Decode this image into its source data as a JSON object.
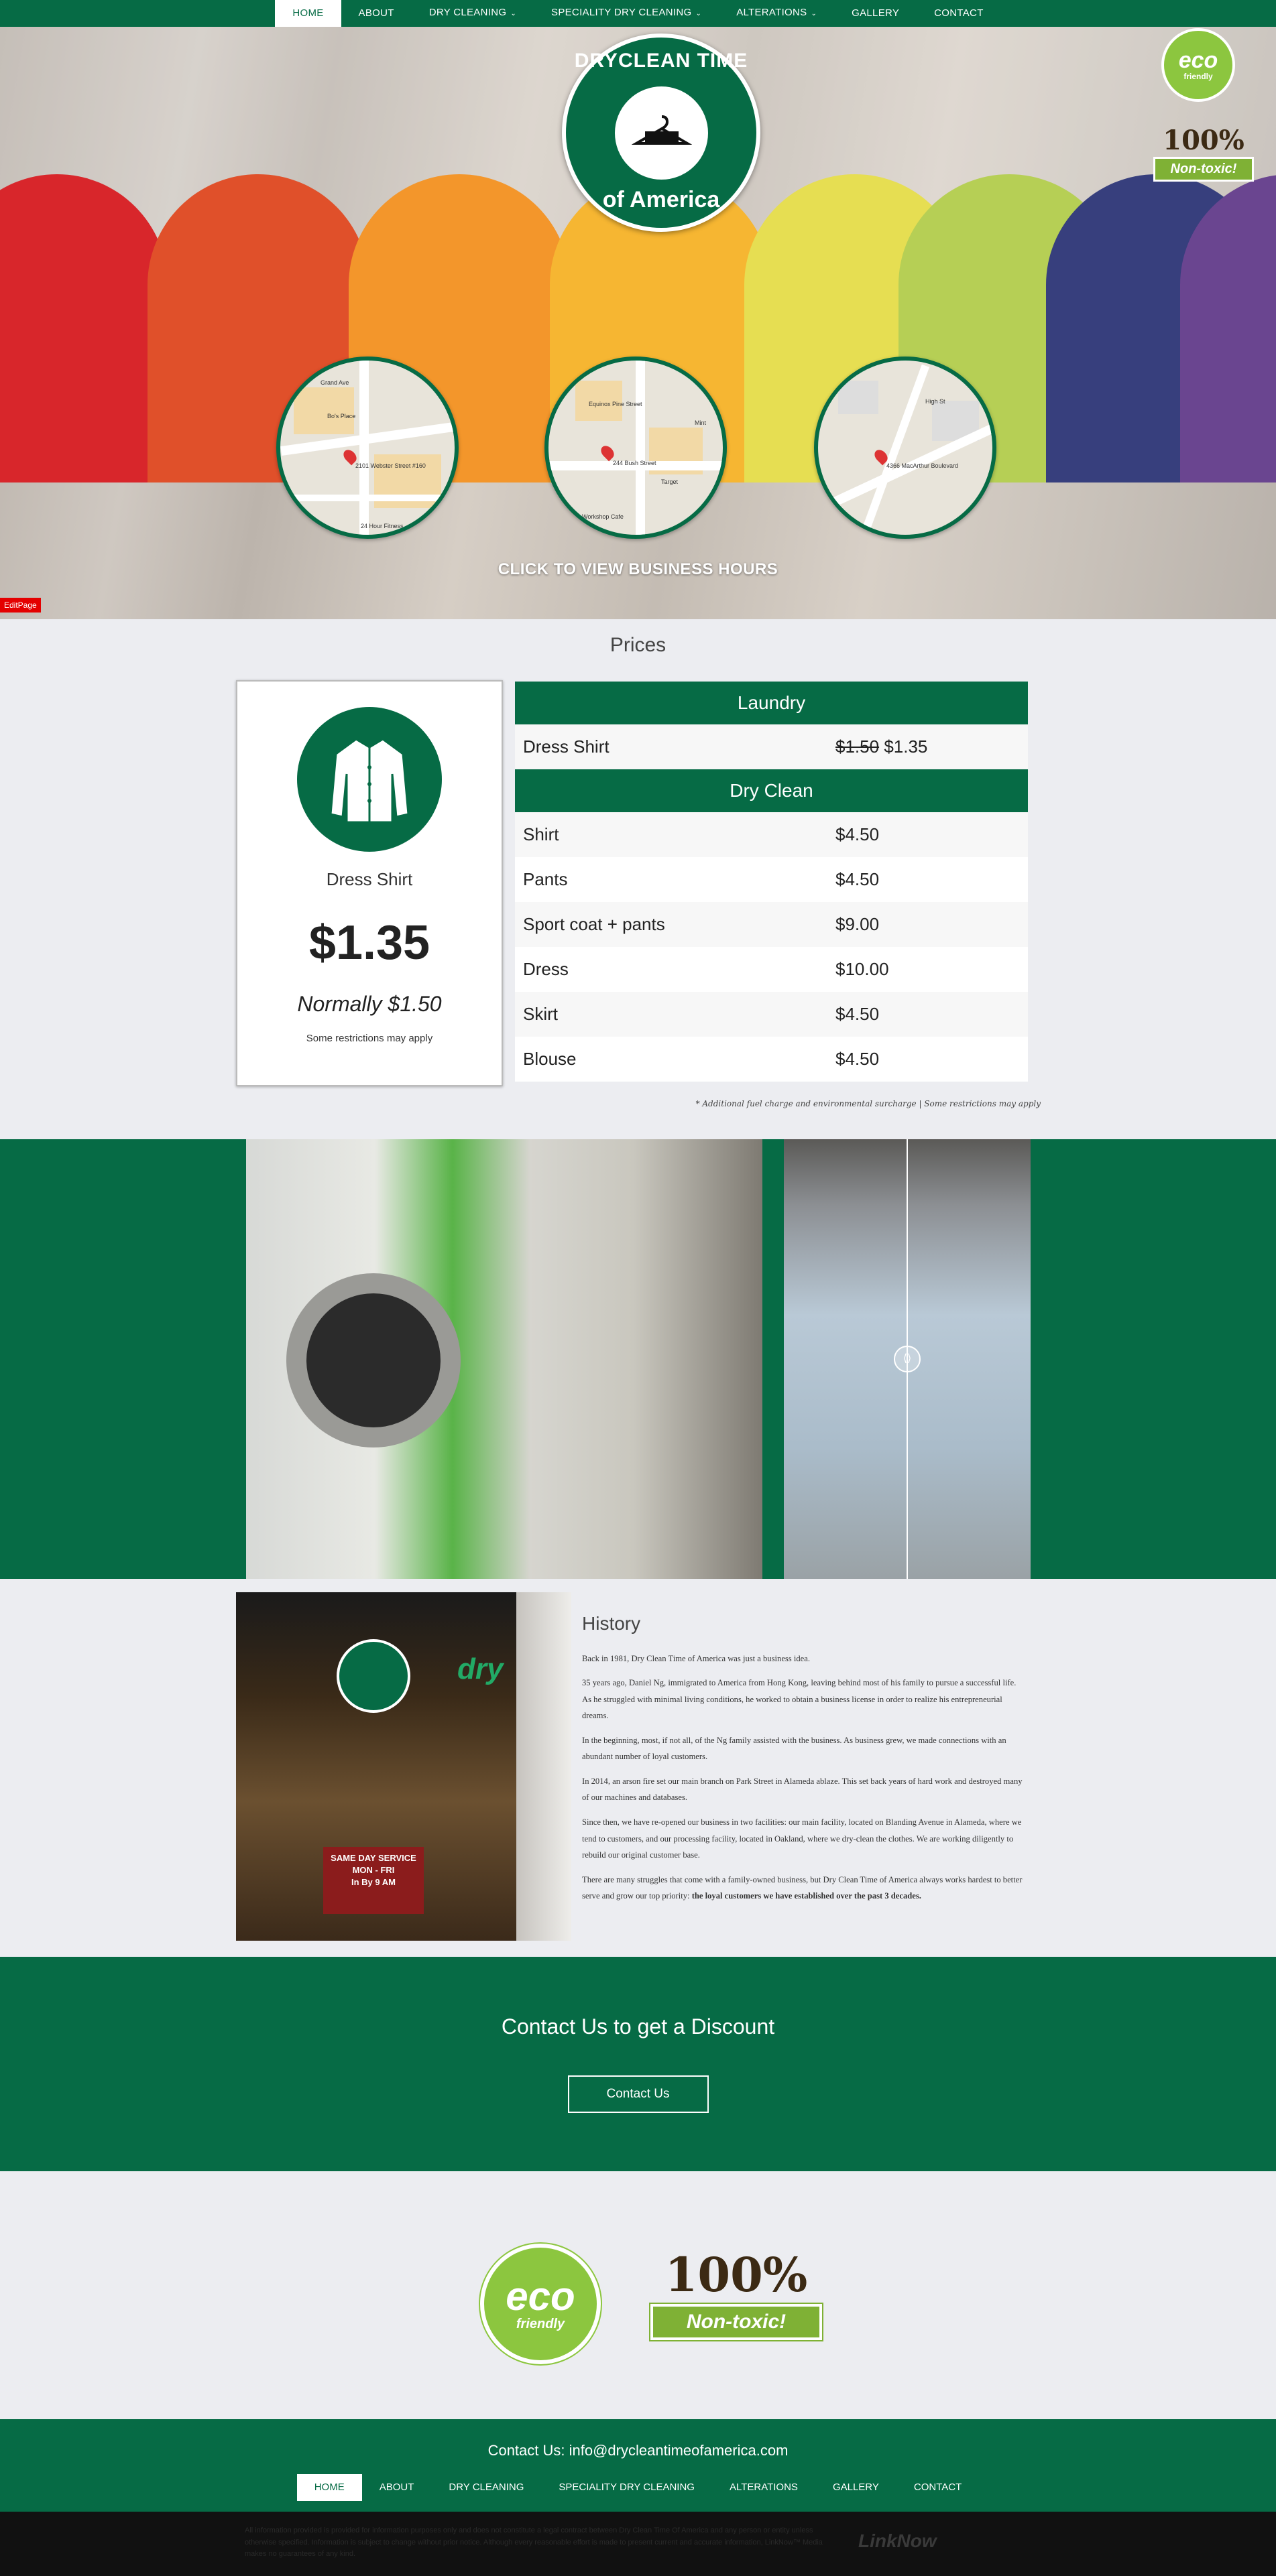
{
  "nav": {
    "items": [
      {
        "label": "HOME",
        "active": true,
        "caret": ""
      },
      {
        "label": "ABOUT",
        "active": false,
        "caret": ""
      },
      {
        "label": "DRY CLEANING",
        "active": false,
        "caret": "⌄"
      },
      {
        "label": "SPECIALITY DRY CLEANING",
        "active": false,
        "caret": "⌄"
      },
      {
        "label": "ALTERATIONS",
        "active": false,
        "caret": "⌄"
      },
      {
        "label": "GALLERY",
        "active": false,
        "caret": ""
      },
      {
        "label": "CONTACT",
        "active": false,
        "caret": ""
      }
    ]
  },
  "hero": {
    "logo_top": "DRYCLEAN TIME",
    "logo_bottom": "of America",
    "eco_big": "eco",
    "eco_small": "friendly",
    "nontoxic_pct": "100%",
    "nontoxic_label": "Non-toxic!",
    "maps": [
      {
        "address": "2101 Webster Street #160",
        "labels": [
          "Grand Ave",
          "Bo's Place",
          "24 Hour Fitness"
        ]
      },
      {
        "address": "244 Bush Street",
        "labels": [
          "Equinox Pine Street",
          "Mint",
          "Target",
          "Workshop Cafe"
        ]
      },
      {
        "address": "4366 MacArthur Boulevard",
        "labels": [
          "High St"
        ]
      }
    ],
    "hours_link": "CLICK TO VIEW BUSINESS HOURS",
    "edit_page": "EditPage"
  },
  "prices": {
    "title": "Prices",
    "promo": {
      "item": "Dress Shirt",
      "price": "$1.35",
      "normally": "Normally $1.50",
      "restrictions": "Some restrictions may apply"
    },
    "laundry_head": "Laundry",
    "laundry": [
      {
        "name": "Dress Shirt",
        "old": "$1.50",
        "value": "$1.35"
      }
    ],
    "dryclean_head": "Dry Clean",
    "dryclean": [
      {
        "name": "Shirt",
        "value": "$4.50"
      },
      {
        "name": "Pants",
        "value": "$4.50"
      },
      {
        "name": "Sport coat + pants",
        "value": "$9.00"
      },
      {
        "name": "Dress",
        "value": "$10.00"
      },
      {
        "name": "Skirt",
        "value": "$4.50"
      },
      {
        "name": "Blouse",
        "value": "$4.50"
      }
    ],
    "fine_print": "* Additional fuel charge and environmental surcharge | Some restrictions may apply"
  },
  "photos": {
    "handle_icon": "⟨⟩"
  },
  "history": {
    "title": "History",
    "storefront": {
      "dry": "dry",
      "poster": [
        "SAME DAY SERVICE",
        "MON - FRI",
        "In By 9 AM"
      ]
    },
    "paragraphs": [
      "Back in 1981, Dry Clean Time of America was just a business idea.",
      "35 years ago, Daniel Ng, immigrated to America from Hong Kong, leaving behind most of his family to pursue a successful life. As he struggled with minimal living conditions, he worked to obtain a business license in order to realize his entrepreneurial dreams.",
      "In the beginning, most, if not all, of the Ng family assisted with the business. As business grew, we made connections with an abundant number of loyal customers.",
      "In 2014, an arson fire set our main branch on Park Street in Alameda ablaze. This set back years of hard work and destroyed many of our machines and databases.",
      "Since then, we have re-opened our business in two facilities: our main facility, located on Blanding Avenue in Alameda, where we tend to customers, and our processing facility, located in Oakland, where we dry-clean the clothes. We are working diligently to rebuild our original customer base."
    ],
    "last_paragraph_start": "There are many struggles that come with a family-owned business, but Dry Clean Time of America always works hardest to better serve and grow our top priority: ",
    "last_paragraph_bold": "the loyal customers we have established over the past 3 decades."
  },
  "cta": {
    "title": "Contact Us to get a Discount",
    "button": "Contact Us"
  },
  "badges": {
    "eco_big": "eco",
    "eco_small": "friendly",
    "nontoxic_pct": "100%",
    "nontoxic_label": "Non-toxic!"
  },
  "footer": {
    "email": "Contact Us: info@drycleantimeofamerica.com",
    "disclaimer": "All information provided is provided for information purposes only and does not constitute a legal contract between Dry Clean Time Of America and any person or entity unless otherwise specified. Information is subject to change without prior notice. Although every reasonable effort is made to present current and accurate information, LinkNow™ Media makes no guarantees of any kind.",
    "linknow": "LinkNow"
  },
  "colors": {
    "brand_green": "#066b45",
    "eco_green": "#8cc63f",
    "edit_red": "#e40000"
  }
}
